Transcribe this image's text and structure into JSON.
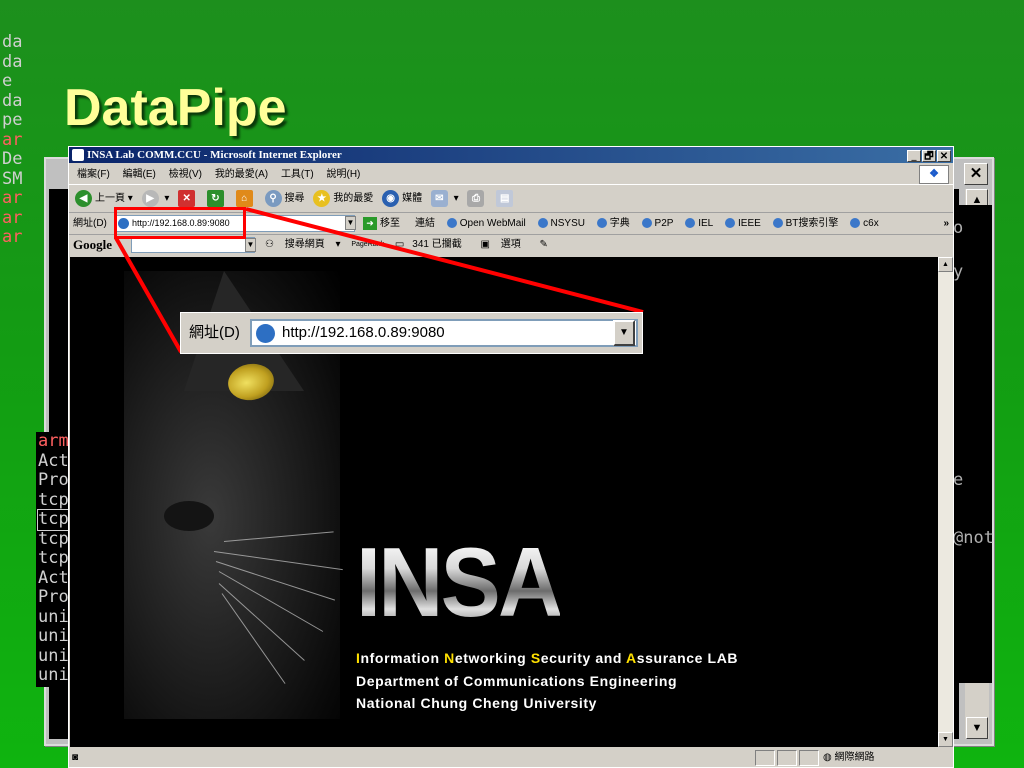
{
  "slide": {
    "title": "DataPipe"
  },
  "terminal": {
    "lines": [
      "da",
      "da",
      "e",
      "da",
      "pe",
      "ar",
      "De",
      "SM",
      "ar",
      "ar",
      "ar"
    ],
    "red_lines": [
      5,
      8,
      9,
      10
    ],
    "lines2": [
      "arm",
      "Act",
      "Pro",
      "tcp",
      "tcp",
      "tcp",
      "tcp",
      "Act",
      "Pro",
      "uni",
      "uni",
      "uni",
      "uni"
    ],
    "right_frags": [
      "o",
      "y",
      "e",
      "@not"
    ],
    "close": "✕"
  },
  "ie": {
    "title": "INSA Lab COMM.CCU - Microsoft Internet Explorer",
    "window_controls": [
      "_",
      "🗗",
      "✕"
    ],
    "menu": [
      "檔案(F)",
      "編輯(E)",
      "檢視(V)",
      "我的最愛(A)",
      "工具(T)",
      "說明(H)"
    ],
    "toolbar": {
      "back": "上一頁",
      "search": "搜尋",
      "favorites": "我的最愛",
      "media": "媒體"
    },
    "address": {
      "label": "網址(D)",
      "value": "http://192.168.0.89:9080",
      "go": "移至",
      "links_label": "連結",
      "links": [
        "Open WebMail",
        "NSYSU",
        "字典",
        "P2P",
        "IEL",
        "IEEE",
        "BT搜索引擎",
        "c6x"
      ],
      "more": "»"
    },
    "google": {
      "brand": "Google",
      "search_web": "搜尋網頁",
      "pagerank": "PageRank",
      "blocked": "341 已攔截",
      "options": "選項"
    },
    "status": {
      "zone": "網際網路"
    }
  },
  "page": {
    "logo": "INSA",
    "line1": [
      {
        "t": "I",
        "y": true
      },
      {
        "t": "nformation ",
        "y": false
      },
      {
        "t": "N",
        "y": true
      },
      {
        "t": "etworking ",
        "y": false
      },
      {
        "t": "S",
        "y": true
      },
      {
        "t": "ecurity and ",
        "y": false
      },
      {
        "t": "A",
        "y": true
      },
      {
        "t": "ssurance LAB",
        "y": false
      }
    ],
    "line2": "Department of Communications Engineering",
    "line3": "National Chung Cheng University"
  },
  "zoom": {
    "label": "網址(D)",
    "value": "http://192.168.0.89:9080"
  },
  "colors": {
    "slide_bg": "#139c13",
    "title": "#ffff99",
    "callout": "#ff0000",
    "accent_letters": "#ffe000"
  }
}
